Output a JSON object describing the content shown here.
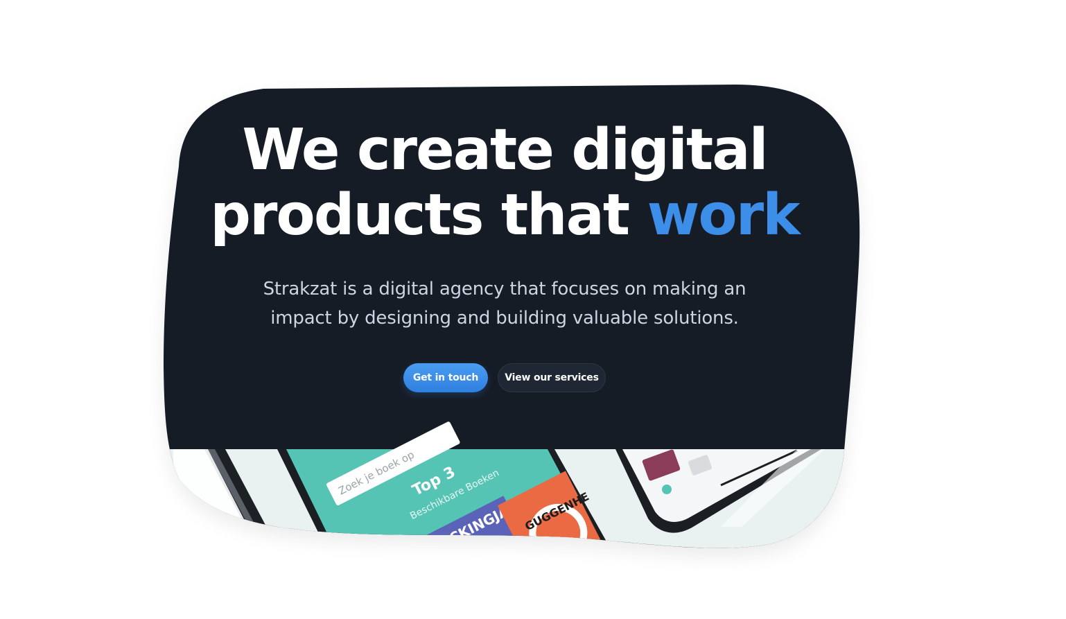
{
  "hero": {
    "headline_line1": "We create digital",
    "headline_line2_prefix": "products that ",
    "headline_accent": "work",
    "subtitle_line1": "Strakzat is a digital agency that focuses on making an",
    "subtitle_line2": "impact by designing and building valuable solutions."
  },
  "cta": {
    "primary_label": "Get in touch",
    "secondary_label": "View our services"
  },
  "showcase": {
    "search_placeholder": "Zoek je boek op",
    "section_title": "Top 3",
    "section_subtitle": "Beschikbare Boeken",
    "book1_title": "MOCKINGJAY",
    "book2_title": "GUGGENHE"
  },
  "colors": {
    "hero_background": "#121b28",
    "accent": "#3d8ee8",
    "subtitle_text": "#cdd5e0",
    "secondary_button": "#1e2733",
    "showcase_background": "#e9f1f1",
    "app_teal": "#56c4b5"
  }
}
